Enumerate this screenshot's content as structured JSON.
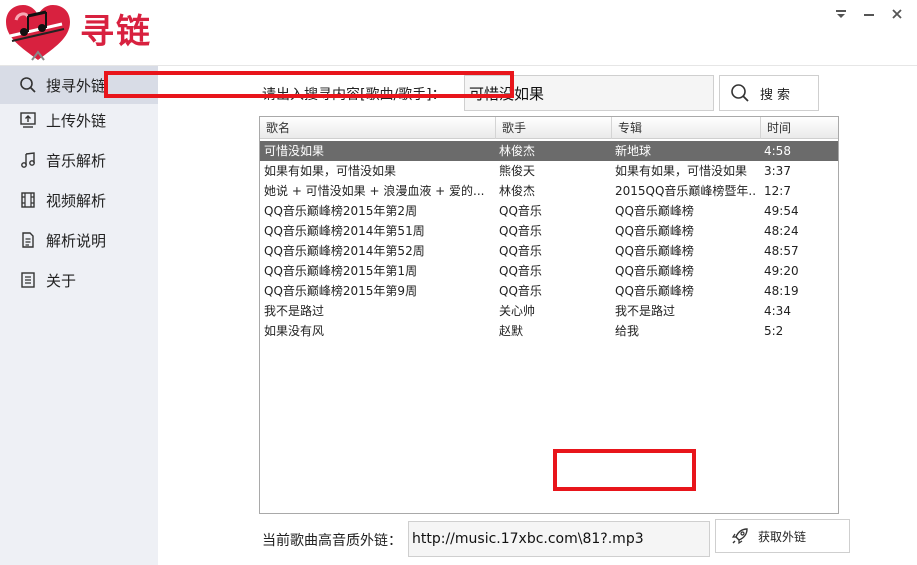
{
  "app": {
    "title": "寻链",
    "colors": {
      "brand": "#d8213f",
      "sidebar_bg": "#eef0f5",
      "sidebar_active": "#d8dce6",
      "selected_row": "#6b6b6b",
      "highlight": "#e8151b"
    }
  },
  "window_controls": {
    "menu_icon": "dropdown-menu-icon",
    "minimize_icon": "minimize-icon",
    "close_icon": "close-icon"
  },
  "sidebar": {
    "items": [
      {
        "label": "搜寻外链",
        "icon": "search-icon",
        "active": true
      },
      {
        "label": "上传外链",
        "icon": "upload-icon",
        "active": false
      },
      {
        "label": "音乐解析",
        "icon": "music-note-icon",
        "active": false
      },
      {
        "label": "视频解析",
        "icon": "film-icon",
        "active": false
      },
      {
        "label": "解析说明",
        "icon": "document-icon",
        "active": false
      },
      {
        "label": "关于",
        "icon": "info-list-icon",
        "active": false
      }
    ]
  },
  "search": {
    "label": "请出入搜寻内容[歌曲/歌手]：",
    "value": "可惜没如果",
    "button_label": "搜索"
  },
  "results": {
    "columns": [
      "歌名",
      "歌手",
      "专辑",
      "时间"
    ],
    "selected_index": 0,
    "rows": [
      [
        "可惜没如果",
        "林俊杰",
        "新地球",
        "4:58"
      ],
      [
        "如果有如果，可惜没如果",
        "熊俊天",
        "如果有如果，可惜没如果",
        "3:37"
      ],
      [
        "她说 + 可惜没如果 + 浪漫血液 + 爱的...",
        "林俊杰",
        "2015QQ音乐巅峰榜暨年...",
        "12:7"
      ],
      [
        "QQ音乐巅峰榜2015年第2周",
        "QQ音乐",
        "QQ音乐巅峰榜",
        "49:54"
      ],
      [
        "QQ音乐巅峰榜2014年第51周",
        "QQ音乐",
        "QQ音乐巅峰榜",
        "48:24"
      ],
      [
        "QQ音乐巅峰榜2014年第52周",
        "QQ音乐",
        "QQ音乐巅峰榜",
        "48:57"
      ],
      [
        "QQ音乐巅峰榜2015年第1周",
        "QQ音乐",
        "QQ音乐巅峰榜",
        "49:20"
      ],
      [
        "QQ音乐巅峰榜2015年第9周",
        "QQ音乐",
        "QQ音乐巅峰榜",
        "48:19"
      ],
      [
        "我不是路过",
        "关心帅",
        "我不是路过",
        "4:34"
      ],
      [
        "如果没有风",
        "赵默",
        "给我",
        "5:2"
      ]
    ]
  },
  "link": {
    "label": "当前歌曲高音质外链：",
    "value": "http://music.17xbc.com\\81?.mp3",
    "button_label": "获取外链",
    "button_icon": "rocket-icon"
  }
}
